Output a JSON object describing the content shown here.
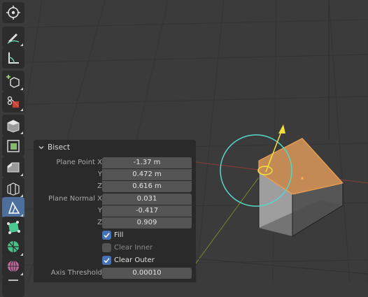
{
  "toolbar": {
    "tools": [
      {
        "name": "cursor-icon",
        "active": false
      },
      {
        "name": "annotate-icon",
        "active": false
      },
      {
        "name": "measure-icon",
        "active": false
      },
      {
        "name": "add-cube-icon",
        "active": false
      },
      {
        "name": "transform-icon",
        "active": false
      },
      {
        "name": "extrude-icon",
        "active": false
      },
      {
        "name": "inset-icon",
        "active": false
      },
      {
        "name": "bevel-icon",
        "active": false
      },
      {
        "name": "loop-cut-icon",
        "active": false
      },
      {
        "name": "knife-bisect-icon",
        "active": true
      },
      {
        "name": "poly-build-icon",
        "active": false
      },
      {
        "name": "spin-icon",
        "active": false
      },
      {
        "name": "smooth-icon",
        "active": false
      },
      {
        "name": "shear-icon",
        "active": false
      }
    ]
  },
  "panel": {
    "title": "Bisect",
    "plane_point": {
      "x_label": "Plane Point X",
      "x_value": "-1.37 m",
      "y_label": "Y",
      "y_value": "0.472 m",
      "z_label": "Z",
      "z_value": "0.616 m"
    },
    "plane_normal": {
      "x_label": "Plane Normal X",
      "x_value": "0.031",
      "y_label": "Y",
      "y_value": "-0.417",
      "z_label": "Z",
      "z_value": "0.909"
    },
    "fill": {
      "label": "Fill",
      "checked": true
    },
    "clear_inner": {
      "label": "Clear Inner",
      "checked": false
    },
    "clear_outer": {
      "label": "Clear Outer",
      "checked": true
    },
    "axis_threshold": {
      "label": "Axis Threshold",
      "value": "0.00010"
    }
  },
  "colors": {
    "viewport_bg": "#3b3b3b",
    "grid_line": "#333333",
    "x_axis": "#8a3b3b",
    "y_axis": "#6e8a2e",
    "gizmo_circle": "#57d6c8",
    "arrow": "#f0e040",
    "selected_face": "#d4965a",
    "active_tool": "#4c6f9e",
    "checkbox_on": "#4772b3"
  }
}
